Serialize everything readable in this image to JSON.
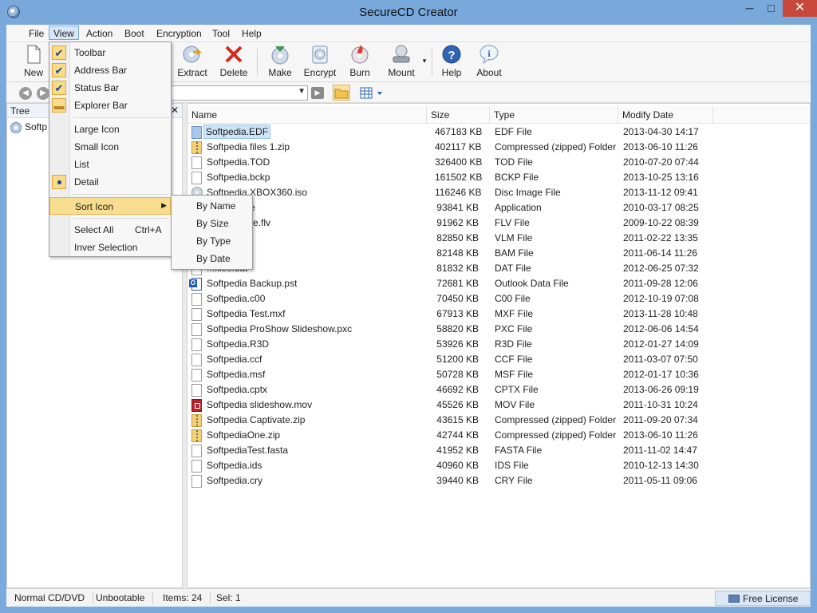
{
  "window": {
    "title": "SecureCD Creator",
    "minimize": "─",
    "maximize": "□",
    "close": "✕"
  },
  "menubar": [
    "File",
    "View",
    "Action",
    "Boot",
    "Encryption",
    "Tool",
    "Help"
  ],
  "toolbar": [
    {
      "label": "New",
      "icon": "new-document-icon"
    },
    {
      "label": "Extract",
      "icon": "extract-icon"
    },
    {
      "label": "Delete",
      "icon": "delete-x-icon"
    },
    {
      "label": "Make",
      "icon": "make-disc-icon"
    },
    {
      "label": "Encrypt",
      "icon": "encrypt-icon"
    },
    {
      "label": "Burn",
      "icon": "burn-disc-icon"
    },
    {
      "label": "Mount",
      "icon": "mount-drive-icon"
    },
    {
      "label": "Help",
      "icon": "help-icon"
    },
    {
      "label": "About",
      "icon": "about-icon"
    }
  ],
  "tree": {
    "header": "Tree",
    "close": "✕",
    "root": "Softp"
  },
  "columns": [
    "Name",
    "Size",
    "Type",
    "Modify Date"
  ],
  "files": [
    {
      "name": "Softpedia.EDF",
      "size": "467183 KB",
      "type": "EDF File",
      "date": "2013-04-30 14:17",
      "icon": "edf"
    },
    {
      "name": "Softpedia files 1.zip",
      "size": "402117 KB",
      "type": "Compressed (zipped) Folder",
      "date": "2013-06-10 11:26",
      "icon": "zip"
    },
    {
      "name": "Softpedia.TOD",
      "size": "326400 KB",
      "type": "TOD File",
      "date": "2010-07-20 07:44",
      "icon": "file"
    },
    {
      "name": "Softpedia.bckp",
      "size": "161502 KB",
      "type": "BCKP File",
      "date": "2013-10-25 13:16",
      "icon": "file"
    },
    {
      "name": "Softpedia.XBOX360.iso",
      "size": "116246 KB",
      "type": "Disc Image File",
      "date": "2013-11-12 09:41",
      "icon": "iso"
    },
    {
      "name": "...nstall.exe",
      "size": "93841 KB",
      "type": "Application",
      "date": "2010-03-17 08:25",
      "icon": "file"
    },
    {
      "name": "...ash movie.flv",
      "size": "91962 KB",
      "type": "FLV File",
      "date": "2009-10-22 08:39",
      "icon": "file"
    },
    {
      "name": "...m",
      "size": "82850 KB",
      "type": "VLM File",
      "date": "2011-02-22 13:35",
      "icon": "file"
    },
    {
      "name": "...am",
      "size": "82148 KB",
      "type": "BAM File",
      "date": "2011-06-14 11:26",
      "icon": "file"
    },
    {
      "name": "...files.dat",
      "size": "81832 KB",
      "type": "DAT File",
      "date": "2012-06-25 07:32",
      "icon": "file"
    },
    {
      "name": "Softpedia Backup.pst",
      "size": "72681 KB",
      "type": "Outlook Data File",
      "date": "2011-09-28 12:06",
      "icon": "pst"
    },
    {
      "name": "Softpedia.c00",
      "size": "70450 KB",
      "type": "C00 File",
      "date": "2012-10-19 07:08",
      "icon": "file"
    },
    {
      "name": "Softpedia Test.mxf",
      "size": "67913 KB",
      "type": "MXF File",
      "date": "2013-11-28 10:48",
      "icon": "file"
    },
    {
      "name": "Softpedia ProShow Slideshow.pxc",
      "size": "58820 KB",
      "type": "PXC File",
      "date": "2012-06-06 14:54",
      "icon": "file"
    },
    {
      "name": "Softpedia.R3D",
      "size": "53926 KB",
      "type": "R3D File",
      "date": "2012-01-27 14:09",
      "icon": "file"
    },
    {
      "name": "Softpedia.ccf",
      "size": "51200 KB",
      "type": "CCF File",
      "date": "2011-03-07 07:50",
      "icon": "file"
    },
    {
      "name": "Softpedia.msf",
      "size": "50728 KB",
      "type": "MSF File",
      "date": "2012-01-17 10:36",
      "icon": "file"
    },
    {
      "name": "Softpedia.cptx",
      "size": "46692 KB",
      "type": "CPTX File",
      "date": "2013-06-26 09:19",
      "icon": "file"
    },
    {
      "name": "Softpedia slideshow.mov",
      "size": "45526 KB",
      "type": "MOV File",
      "date": "2011-10-31 10:24",
      "icon": "mov"
    },
    {
      "name": "Softpedia Captivate.zip",
      "size": "43615 KB",
      "type": "Compressed (zipped) Folder",
      "date": "2011-09-20 07:34",
      "icon": "zip"
    },
    {
      "name": "SoftpediaOne.zip",
      "size": "42744 KB",
      "type": "Compressed (zipped) Folder",
      "date": "2013-06-10 11:26",
      "icon": "zip"
    },
    {
      "name": "SoftpediaTest.fasta",
      "size": "41952 KB",
      "type": "FASTA File",
      "date": "2011-11-02 14:47",
      "icon": "file"
    },
    {
      "name": "Softpedia.ids",
      "size": "40960 KB",
      "type": "IDS File",
      "date": "2010-12-13 14:30",
      "icon": "file"
    },
    {
      "name": "Softpedia.cry",
      "size": "39440 KB",
      "type": "CRY File",
      "date": "2011-05-11 09:06",
      "icon": "file"
    }
  ],
  "view_menu": {
    "toolbar": "Toolbar",
    "address_bar": "Address Bar",
    "status_bar": "Status Bar",
    "explorer_bar": "Explorer Bar",
    "large_icon": "Large Icon",
    "small_icon": "Small Icon",
    "list": "List",
    "detail": "Detail",
    "sort_icon": "Sort Icon",
    "select_all": "Select All",
    "select_all_shortcut": "Ctrl+A",
    "inver_selection": "Inver Selection",
    "checkmark": "✔"
  },
  "sort_menu": [
    "By Name",
    "By Size",
    "By Type",
    "By Date"
  ],
  "statusbar": {
    "media": "Normal CD/DVD",
    "boot": "Unbootable",
    "items": "Items: 24",
    "sel": "Sel: 1",
    "license": "Free License"
  },
  "colors": {
    "titlebar": "#79a8db",
    "close_button": "#c7473b",
    "menu_highlight": "#f7dd8f",
    "selection": "#cde4f7"
  }
}
